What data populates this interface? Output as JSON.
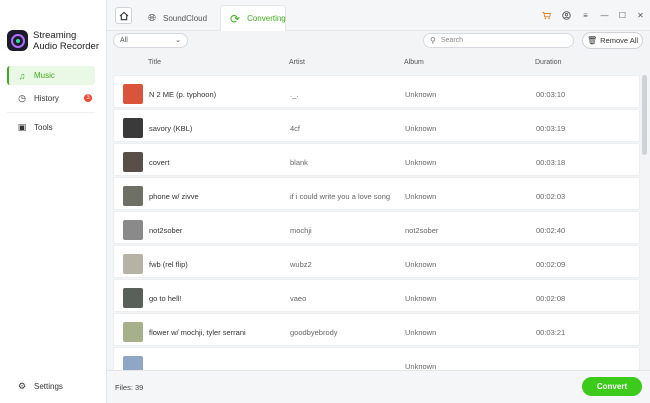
{
  "app": {
    "name_line1": "Streaming",
    "name_line2": "Audio Recorder"
  },
  "sidebar": {
    "items": [
      {
        "label": "Music",
        "icon": "music-note-icon",
        "active": true
      },
      {
        "label": "History",
        "icon": "history-icon",
        "badge": "3"
      },
      {
        "label": "Tools",
        "icon": "toolbox-icon"
      }
    ],
    "settings_label": "Settings"
  },
  "tabs": [
    {
      "label": "SoundCloud",
      "icon": "globe-icon"
    },
    {
      "label": "Converting",
      "icon": "refresh-icon",
      "active": true
    }
  ],
  "window_controls": [
    "cart-icon",
    "account-icon",
    "menu-icon",
    "minimize-icon",
    "maximize-icon",
    "close-icon"
  ],
  "toolbar": {
    "filter_value": "All",
    "search_placeholder": "Search",
    "remove_all_label": "Remove All"
  },
  "table": {
    "headers": {
      "title": "Title",
      "artist": "Artist",
      "album": "Album",
      "duration": "Duration"
    },
    "rows": [
      {
        "title": "N 2 ME (p. typhoon)",
        "artist": "._.",
        "album": "Unknown",
        "duration": "00:03:10",
        "thumb": "#d9543a"
      },
      {
        "title": "savory (KBL)",
        "artist": "4cf",
        "album": "Unknown",
        "duration": "00:03:19",
        "thumb": "#3a3a3a"
      },
      {
        "title": "covert",
        "artist": "blank",
        "album": "Unknown",
        "duration": "00:03:18",
        "thumb": "#5a4f48"
      },
      {
        "title": "phone w/ zivve",
        "artist": "if i could write you a love song",
        "album": "Unknown",
        "duration": "00:02:03",
        "thumb": "#6e6f66"
      },
      {
        "title": "not2sober",
        "artist": "mochji",
        "album": "not2sober",
        "duration": "00:02:40",
        "thumb": "#8a8a8a"
      },
      {
        "title": "fwb (rel flip)",
        "artist": "wubz2",
        "album": "Unknown",
        "duration": "00:02:09",
        "thumb": "#b7b2a6"
      },
      {
        "title": "go to hell!",
        "artist": "vaeo",
        "album": "Unknown",
        "duration": "00:02:08",
        "thumb": "#59605a"
      },
      {
        "title": "flower w/ mochji, tyler serrani",
        "artist": "goodbyebrody",
        "album": "Unknown",
        "duration": "00:03:21",
        "thumb": "#a6b08b"
      },
      {
        "title": "",
        "artist": "",
        "album": "Unknown",
        "duration": "",
        "thumb": "#8fa6c4"
      }
    ]
  },
  "footer": {
    "files_label": "Files: 39",
    "convert_label": "Convert"
  },
  "colors": {
    "accent": "#3fae1e",
    "convert": "#3ccb1a",
    "badge": "#f1482f"
  }
}
